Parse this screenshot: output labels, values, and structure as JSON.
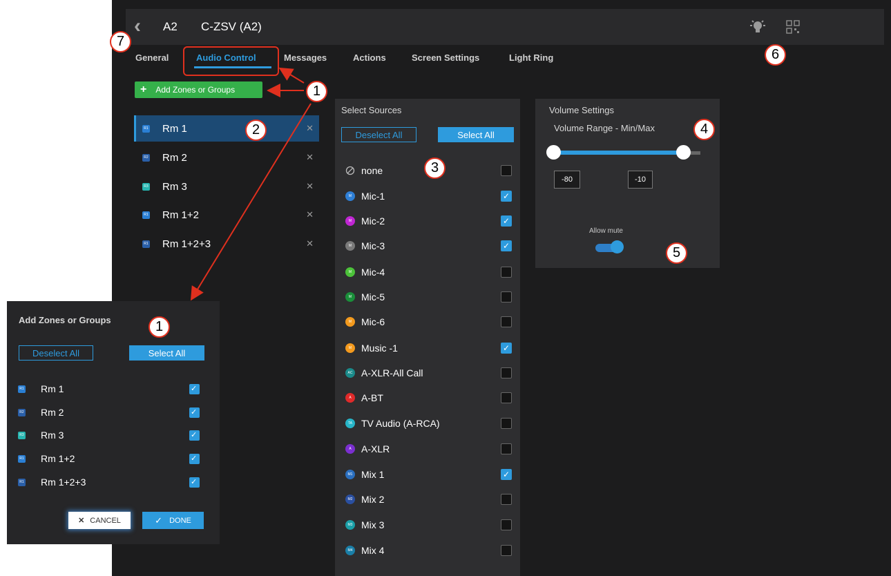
{
  "header": {
    "back_icon": "chevron-left-icon",
    "device": "A2",
    "name": "C-ZSV (A2)",
    "icons": [
      "lightbulb-icon",
      "qr-code-icon"
    ]
  },
  "tabs": [
    "General",
    "Audio Control",
    "Messages",
    "Actions",
    "Screen Settings",
    "Light Ring"
  ],
  "active_tab": "Audio Control",
  "add_zones_button": "Add Zones or Groups",
  "zones": [
    {
      "label": "Rm 1",
      "icon_text": "R1",
      "color": "#2a7fd4",
      "selected": true
    },
    {
      "label": "Rm 2",
      "icon_text": "R2",
      "color": "#2a5fa8",
      "selected": false
    },
    {
      "label": "Rm 3",
      "icon_text": "R3",
      "color": "#27b5b0",
      "selected": false
    },
    {
      "label": "Rm 1+2",
      "icon_text": "R1",
      "color": "#2a7fd4",
      "selected": false
    },
    {
      "label": "Rm 1+2+3",
      "icon_text": "R1",
      "color": "#2a5fa8",
      "selected": false
    }
  ],
  "sources_panel": {
    "title": "Select Sources",
    "deselect_all": "Deselect All",
    "select_all": "Select All",
    "items": [
      {
        "label": "none",
        "icon": "none",
        "color": "#bbbbbb",
        "checked": false
      },
      {
        "label": "Mic-1",
        "icon": "M",
        "color": "#2e7fd6",
        "checked": true
      },
      {
        "label": "Mic-2",
        "icon": "M",
        "color": "#c026d3",
        "checked": true
      },
      {
        "label": "Mic-3",
        "icon": "M",
        "color": "#7a7a7a",
        "checked": true
      },
      {
        "label": "Mic-4",
        "icon": "M",
        "color": "#4cc23a",
        "checked": false
      },
      {
        "label": "Mic-5",
        "icon": "M",
        "color": "#1a8f3a",
        "checked": false
      },
      {
        "label": "Mic-6",
        "icon": "M",
        "color": "#f39a1e",
        "checked": false
      },
      {
        "label": "Music -1",
        "icon": "M",
        "color": "#f39a1e",
        "checked": true
      },
      {
        "label": "A-XLR-All Call",
        "icon": "AC",
        "color": "#1a8a8a",
        "checked": false
      },
      {
        "label": "A-BT",
        "icon": "A",
        "color": "#e02a2a",
        "checked": false
      },
      {
        "label": "TV Audio (A-RCA)",
        "icon": "TA",
        "color": "#27b5c8",
        "checked": false
      },
      {
        "label": "A-XLR",
        "icon": "A",
        "color": "#7b2fd0",
        "checked": false
      },
      {
        "label": "Mix 1",
        "icon": "M1",
        "color": "#2a6fc0",
        "checked": true
      },
      {
        "label": "Mix 2",
        "icon": "M2",
        "color": "#2a4fa0",
        "checked": false
      },
      {
        "label": "Mix 3",
        "icon": "M3",
        "color": "#1a9fa8",
        "checked": false
      },
      {
        "label": "Mix 4",
        "icon": "M4",
        "color": "#1a7fa8",
        "checked": false
      }
    ]
  },
  "volume_panel": {
    "title": "Volume Settings",
    "range_label": "Volume Range - Min/Max",
    "min": "-80",
    "max": "-10",
    "allow_mute_label": "Allow mute",
    "allow_mute": true
  },
  "popup": {
    "title": "Add Zones or Groups",
    "deselect_all": "Deselect All",
    "select_all": "Select All",
    "items": [
      {
        "label": "Rm 1",
        "icon_text": "R1",
        "color": "#2a7fd4",
        "checked": true
      },
      {
        "label": "Rm 2",
        "icon_text": "R2",
        "color": "#2a5fa8",
        "checked": true
      },
      {
        "label": "Rm 3",
        "icon_text": "R3",
        "color": "#27b5b0",
        "checked": true
      },
      {
        "label": "Rm 1+2",
        "icon_text": "R1",
        "color": "#2a7fd4",
        "checked": true
      },
      {
        "label": "Rm 1+2+3",
        "icon_text": "R1",
        "color": "#2a5fa8",
        "checked": true
      }
    ],
    "cancel": "CANCEL",
    "done": "DONE"
  },
  "callouts": [
    "1",
    "2",
    "3",
    "4",
    "5",
    "6",
    "7",
    "1",
    "1"
  ],
  "accent_color": "#2e9bdd",
  "callout_color": "#e0301e"
}
